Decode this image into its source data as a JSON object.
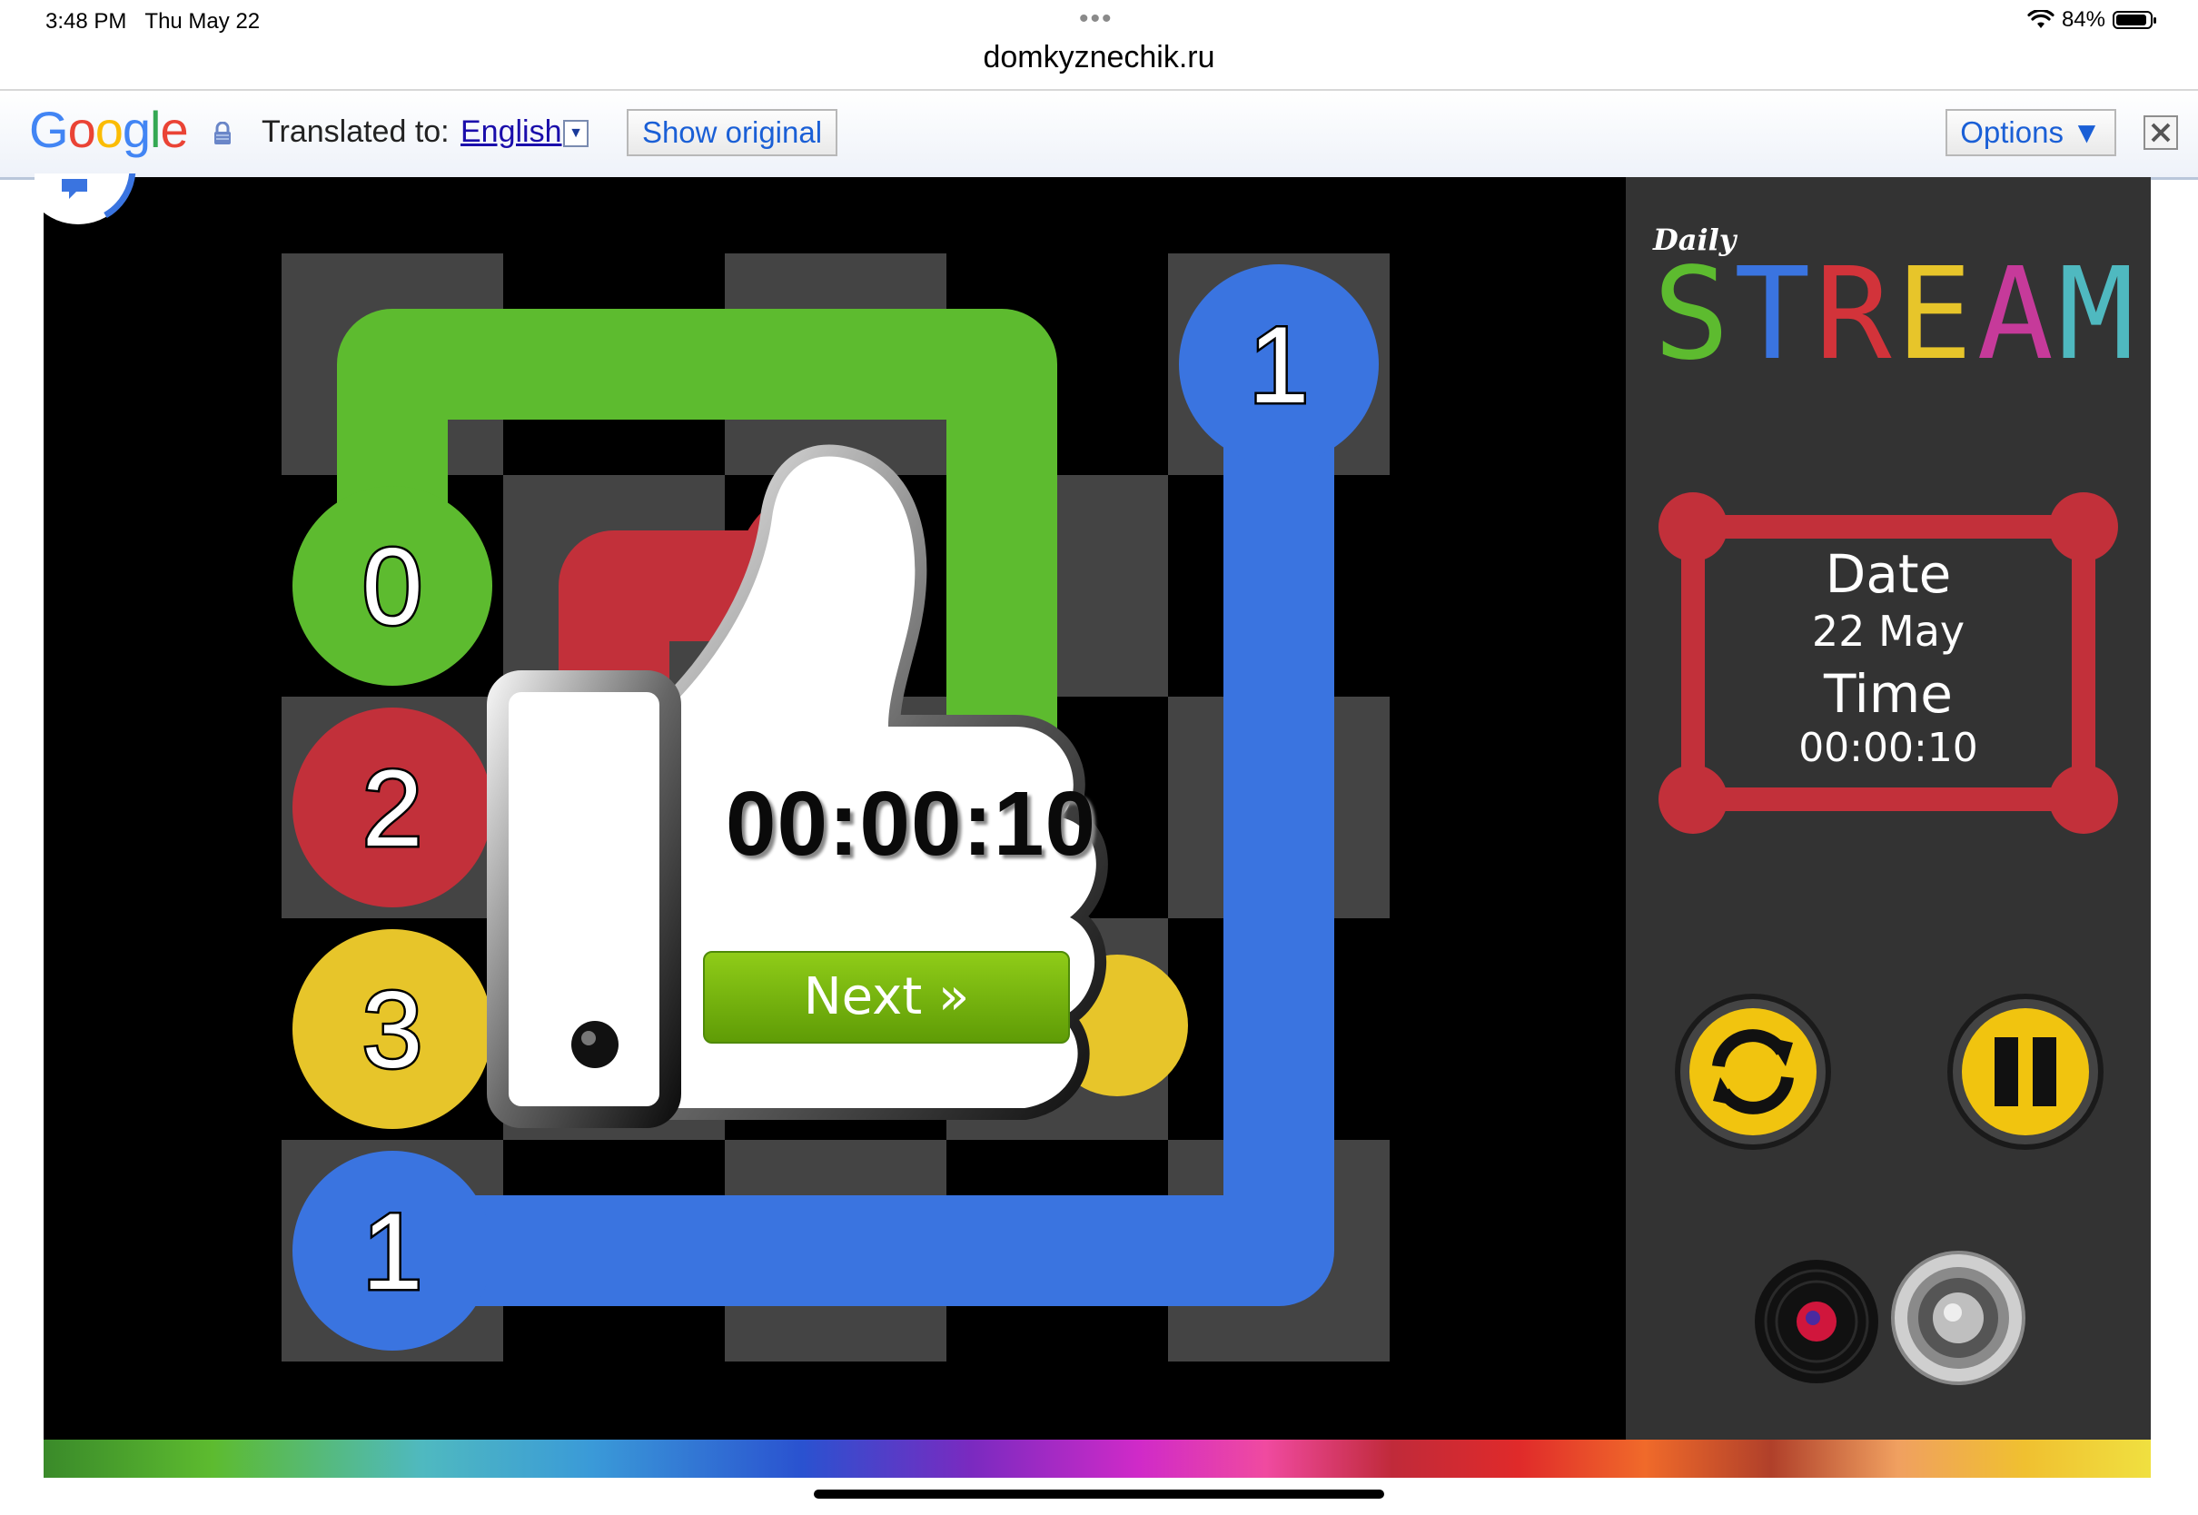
{
  "status_bar": {
    "time": "3:48 PM",
    "date": "Thu May 22",
    "battery": "84%"
  },
  "browser": {
    "url": "domkyznechik.ru"
  },
  "translate_bar": {
    "logo": "Google",
    "translated_to_label": "Translated to:",
    "language": "English",
    "show_original": "Show original",
    "options": "Options ▼"
  },
  "game": {
    "logo_small": "Daily",
    "logo_letters": [
      "S",
      "T",
      "R",
      "E",
      "A",
      "M"
    ],
    "logo_colors": [
      "#5dbb2f",
      "#3a74e0",
      "#d2333a",
      "#e7c52a",
      "#c63a9a",
      "#4fb9c0"
    ],
    "date_label": "Date",
    "date_value": "22 May",
    "time_label": "Time",
    "time_value": "00:00:10",
    "result_time": "00:00:10",
    "next_label": "Next »",
    "nodes": [
      {
        "label": "0",
        "color": "#5dbb2f"
      },
      {
        "label": "1",
        "color": "#3a74e0"
      },
      {
        "label": "2",
        "color": "#c2303a"
      },
      {
        "label": "3",
        "color": "#e7c52a"
      },
      {
        "label": "1",
        "color": "#3a74e0"
      }
    ],
    "buttons": {
      "restart": "restart-icon",
      "pause": "pause-icon",
      "music": "record-icon",
      "sound": "speaker-icon"
    },
    "colors": {
      "board_light": "#444444",
      "board_dark": "#000000",
      "panel": "#333333",
      "frame_red": "#c2303a",
      "button_yellow": "#f1c40f"
    }
  }
}
